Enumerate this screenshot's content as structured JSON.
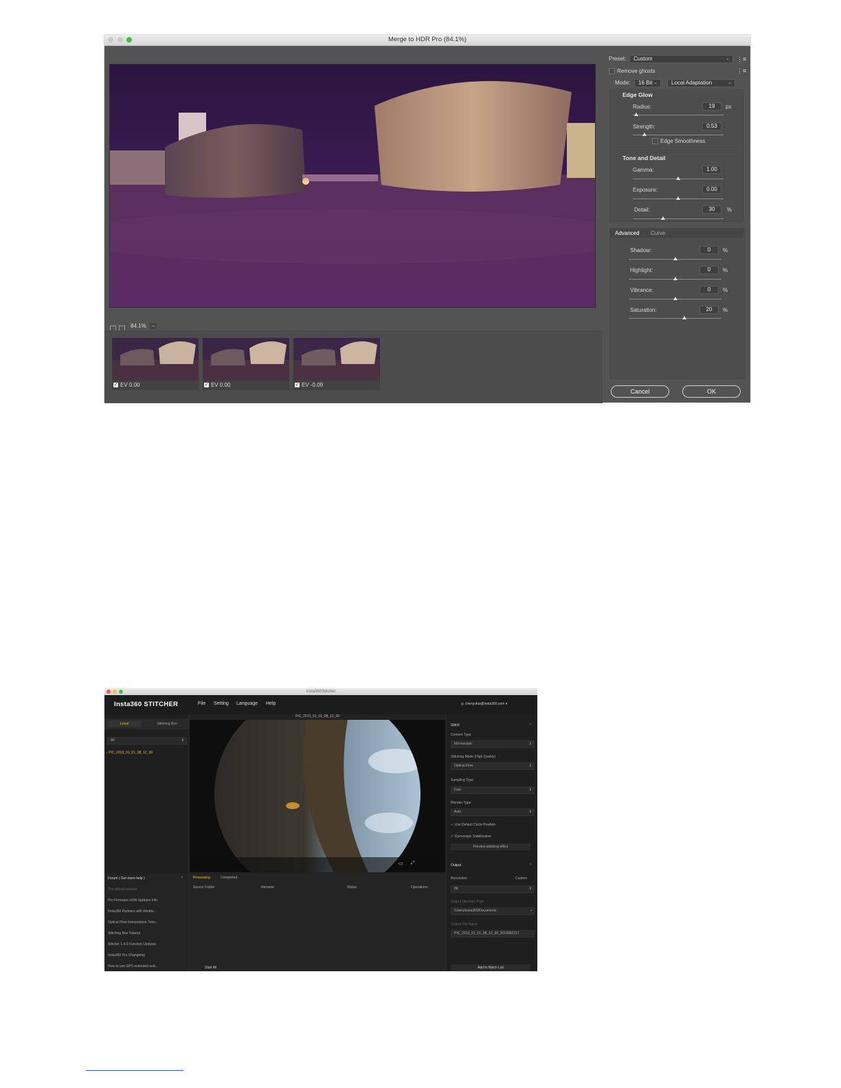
{
  "hdr": {
    "title": "Merge to HDR Pro (84.1%)",
    "zoom": "84.1%",
    "zoom_menu": "–",
    "thumbnails": [
      "EV 0.00",
      "EV 0.00",
      "EV -0.09"
    ],
    "preset_label": "Preset:",
    "preset_value": "Custom",
    "remove_ghosts": "Remove ghosts",
    "mode_label": "Mode:",
    "mode_bits": "16 Bit",
    "mode_method": "Local Adaptation",
    "edge_glow": {
      "title": "Edge Glow",
      "radius_label": "Radius:",
      "radius_value": "19",
      "radius_unit": "px",
      "radius_level": 0.04,
      "strength_label": "Strength:",
      "strength_value": "0.53",
      "strength_level": 0.13,
      "edge_smoothness": "Edge Smoothness"
    },
    "tone_detail": {
      "title": "Tone and Detail",
      "gamma_label": "Gamma:",
      "gamma_value": "1.00",
      "gamma_level": 0.5,
      "exposure_label": "Exposure:",
      "exposure_value": "0.00",
      "exposure_level": 0.5,
      "detail_label": "Detail:",
      "detail_value": "30",
      "detail_unit": "%",
      "detail_level": 0.33
    },
    "tabs": [
      "Advanced",
      "Curve"
    ],
    "advanced": {
      "shadow_label": "Shadow:",
      "shadow_value": "0",
      "shadow_level": 0.5,
      "highlight_label": "Highlight:",
      "highlight_value": "0",
      "highlight_level": 0.5,
      "vibrance_label": "Vibrance:",
      "vibrance_value": "0",
      "vibrance_level": 0.5,
      "saturation_label": "Saturation:",
      "saturation_value": "20",
      "saturation_level": 0.6,
      "unit": "%"
    },
    "cancel": "Cancel",
    "ok": "OK"
  },
  "stitcher": {
    "title": "insta360Stitcher",
    "brand": "Insta360 STITCHER",
    "menu": [
      "File",
      "Setting",
      "Language",
      "Help"
    ],
    "account": "chenyuhui@insta360.com",
    "tabs": [
      "Local",
      "Stitching Box"
    ],
    "filter": "All",
    "file_item": "PIC_2013_01_01_08_12_39",
    "preview_title": "PIC_2013_01_01_08_12_39",
    "forum_title": "Forum ( Get more help )",
    "forum_items": [
      "The official website",
      "Pro Firmware v206 Updates Info",
      "Insta360 Partners with Wedbe...",
      "Optical Flow Interpolation Tutor...",
      "Stitching Box Tutorial",
      "Stitcher 1.4.0 Function Updates",
      "Insta360 Pro Changelog",
      "How to use GPS extended and..."
    ],
    "queue_tabs": [
      "Processing",
      "Completed"
    ],
    "columns": [
      "Source Folder",
      "Rename",
      "Status",
      "Operations"
    ],
    "start_all": "Start All",
    "stitch_section": "Stitch",
    "content_type_label": "Content Type",
    "content_type": "Monoscopic",
    "stitch_mode_label": "Stitching Mode (High Quality)",
    "stitch_mode": "Optical Flow",
    "sampling_label": "Sampling Type",
    "sampling": "Fast",
    "blender_label": "Blender Type",
    "blender": "Auto",
    "opt_circle": "Use Default Circle Position",
    "opt_gyro": "Gyroscopic Stabilization",
    "preview_btn": "Preview stitching effect",
    "output_section": "Output",
    "resolution_label": "Resolution",
    "custom": "Custom",
    "resolution": "8K",
    "out_dir_label": "Output Directory Path",
    "out_dir": "/Users/insta360/Documents",
    "out_name_label": "Output File Name",
    "out_name": "PIC_2013_01_01_08_12_39_2018082217",
    "add_batch": "Add to Batch List"
  }
}
